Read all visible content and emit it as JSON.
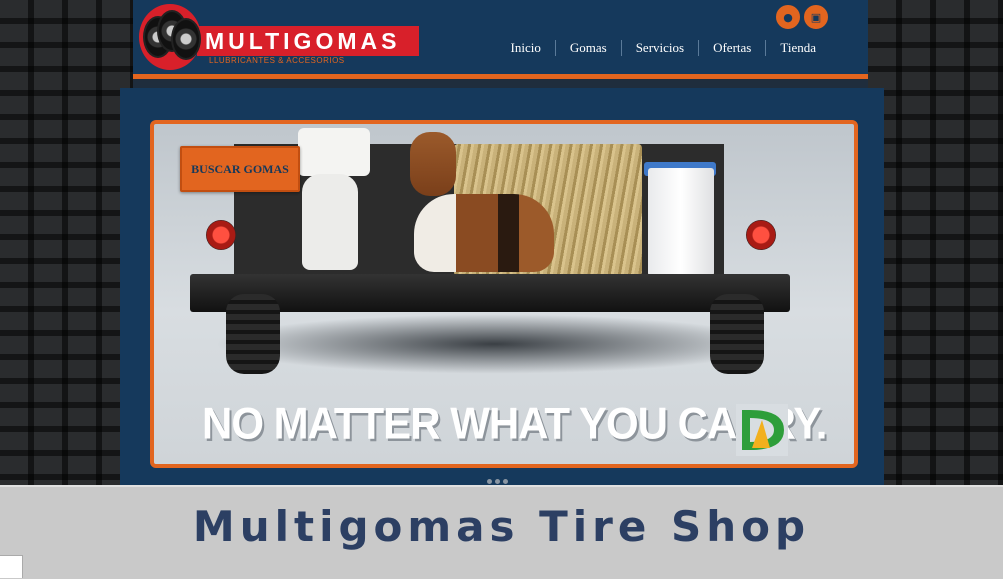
{
  "brand": {
    "name": "MULTIGOMAS",
    "tagline": "LLUBRICANTES & ACCESORIOS"
  },
  "header": {
    "icons": [
      "user-icon",
      "cart-icon"
    ],
    "nav": [
      "Inicio",
      "Gomas",
      "Servicios",
      "Ofertas",
      "Tienda"
    ]
  },
  "slide": {
    "cta_label": "BUSCAR GOMAS",
    "slogan": "NO MATTER WHAT YOU CARRY."
  },
  "carousel": {
    "dots": 3
  },
  "caption": "Multigomas Tire Shop",
  "colors": {
    "accent": "#e2651f",
    "header": "#15395c",
    "logo_red": "#d8202a",
    "caption_text": "#2c3f63"
  }
}
